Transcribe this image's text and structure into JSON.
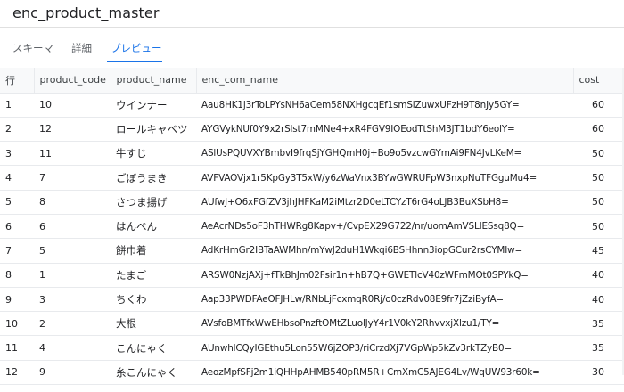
{
  "window": {
    "title": "enc_product_master"
  },
  "tabs": [
    {
      "label": "スキーマ",
      "active": false
    },
    {
      "label": "詳細",
      "active": false
    },
    {
      "label": "プレビュー",
      "active": true
    }
  ],
  "table": {
    "columns": [
      "行",
      "product_code",
      "product_name",
      "enc_com_name",
      "cost"
    ],
    "rows": [
      [
        "1",
        "10",
        "ウインナー",
        "Aau8HK1j3rToLPYsNH6aCem58NXHgcqEf1smSlZuwxUFzH9T8nJy5GY=",
        "60"
      ],
      [
        "2",
        "12",
        "ロールキャベツ",
        "AYGVykNUf0Y9x2rSlst7mMNe4+xR4FGV9IOEodTtShM3JT1bdY6eolY=",
        "60"
      ],
      [
        "3",
        "11",
        "牛すじ",
        "ASlUsPQUVXYBmbvI9frqSjYGHQmH0j+Bo9o5vzcwGYmAi9FN4JvLKeM=",
        "50"
      ],
      [
        "4",
        "7",
        "ごぼうまき",
        "AVFVAOVjx1r5KpGy3T5xW/y6zWaVnx3BYwGWRUFpW3nxpNuTFGguMu4=",
        "50"
      ],
      [
        "5",
        "8",
        "さつま揚げ",
        "AUfwJ+O6xFGfZV3jhJHFKaM2iMtzr2D0eLTCYzT6rG4oLJB3BuXSbH8=",
        "50"
      ],
      [
        "6",
        "6",
        "はんぺん",
        "AeAcrNDs5oF3hTHWRg8Kapv+/CvpEX29G722/nr/uomAmVSLIESsq8Q=",
        "50"
      ],
      [
        "7",
        "5",
        "餅巾着",
        "AdKrHmGr2IBTaAWMhn/mYwJ2duH1Wkqi6BSHhnn3iopGCur2rsCYMIw=",
        "45"
      ],
      [
        "8",
        "1",
        "たまご",
        "ARSW0NzjAXj+fTkBhJm02Fsir1n+hB7Q+GWETlcV40zWFmMOt0SPYkQ=",
        "40"
      ],
      [
        "9",
        "3",
        "ちくわ",
        "Aap33PWDFAeOFJHLw/RNbLjFcxmqR0Rj/o0czRdv08E9fr7jZziByfA=",
        "40"
      ],
      [
        "10",
        "2",
        "大根",
        "AVsfoBMTfxWwEHbsoPnzftOMtZLuolJyY4r1V0kY2RhvvxjXlzu1/TY=",
        "35"
      ],
      [
        "11",
        "4",
        "こんにゃく",
        "AUnwhlCQyIGEthu5Lon55W6jZOP3/riCrzdXj7VGpWp5kZv3rkTZyB0=",
        "35"
      ],
      [
        "12",
        "9",
        "糸こんにゃく",
        "AeozMpfSFj2m1iQHHpAHMB540pRM5R+CmXmC5AJEG4Lv/WqUW93r60k=",
        "30"
      ]
    ]
  }
}
